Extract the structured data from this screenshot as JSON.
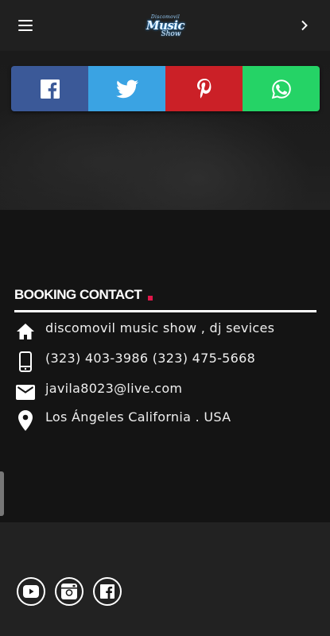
{
  "header": {
    "menu_icon": "hamburger-menu-icon",
    "logo": {
      "line1": "Discomovil",
      "line2": "Music",
      "line3": "Show"
    },
    "next_icon": "chevron-right-icon"
  },
  "share_bar": [
    {
      "name": "facebook",
      "icon": "facebook-icon",
      "color": "#3b5998"
    },
    {
      "name": "twitter",
      "icon": "twitter-icon",
      "color": "#3aa3e3"
    },
    {
      "name": "pinterest",
      "icon": "pinterest-icon",
      "color": "#cb2027"
    },
    {
      "name": "whatsapp",
      "icon": "whatsapp-icon",
      "color": "#25d366"
    }
  ],
  "booking": {
    "title": "BOOKING CONTACT",
    "accent_color": "#e0174a",
    "items": [
      {
        "icon": "home-icon",
        "text": "discomovil music show , dj sevices"
      },
      {
        "icon": "phone-icon",
        "text": "(323) 403-3986 (323) 475-5668"
      },
      {
        "icon": "email-icon",
        "text": "javila8023@live.com"
      },
      {
        "icon": "location-pin-icon",
        "text": "Los Ángeles California . USA"
      }
    ]
  },
  "footer": {
    "social_links": [
      {
        "icon": "youtube-icon"
      },
      {
        "icon": "instagram-icon"
      },
      {
        "icon": "facebook-icon"
      }
    ]
  }
}
